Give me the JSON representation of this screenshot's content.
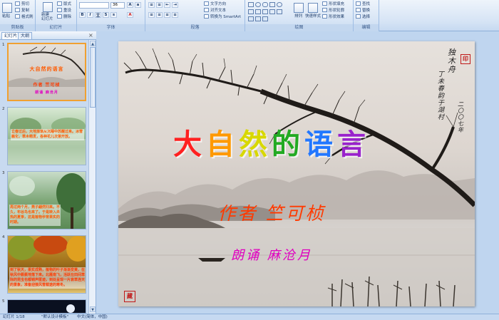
{
  "ribbon": {
    "groups": [
      {
        "name": "剪贴板",
        "items": [
          "剪切",
          "复制",
          "格式刷"
        ],
        "big": "粘贴"
      },
      {
        "name": "幻灯片",
        "items": [
          "版式",
          "重设",
          "删除"
        ],
        "big": "新建\n幻灯片"
      },
      {
        "name": "字体",
        "font_size": "36"
      },
      {
        "name": "段落",
        "items": [
          "文字方向",
          "对齐文本",
          "转换为 SmartArt"
        ]
      },
      {
        "name": "绘图",
        "items": [
          "排列",
          "快速样式",
          "形状填充",
          "形状轮廓",
          "形状效果"
        ]
      },
      {
        "name": "编辑",
        "items": [
          "查找",
          "替换",
          "选择"
        ]
      }
    ]
  },
  "pane": {
    "tabs": [
      "幻灯片",
      "大纲"
    ],
    "slides": [
      {
        "num": "1",
        "title": "大自然的语言",
        "subtitle": "作者 竺可桢",
        "reader": "朗诵 麻沧月"
      },
      {
        "num": "2",
        "text": "立春过后，大地渐渐从沉睡中苏醒过来。冰雪融化，草木萌发，各种花儿次第开放。"
      },
      {
        "num": "3",
        "text": "再过两个月，燕子翩然归来。不久，布谷鸟也来了。于是转入炎热的夏季，这是植物孕育果实的时期。"
      },
      {
        "num": "4",
        "text": "到了秋天，果实成熟，植物的叶子渐渐变黄，在秋风中簌簌地落下来。北雁南飞，活跃在田间草际的昆虫也都销声匿迹。到处呈现一片衰草连天的景象，准备迎接风雪载途的寒冬。"
      },
      {
        "num": "5"
      }
    ]
  },
  "slide": {
    "title_chars": [
      "大",
      "自",
      "然",
      "的",
      "语",
      "言"
    ],
    "title_colors": [
      "#ff2020",
      "#ff9900",
      "#d8d800",
      "#22aa22",
      "#2277ff",
      "#9922cc"
    ],
    "author": "作者  竺可桢",
    "reader": "朗诵  麻沧月",
    "calligraphy": [
      "独木舟",
      "丁未春韵于湖村",
      "二〇〇七年"
    ],
    "seal_top": "印",
    "seal_bottom": "藏"
  },
  "status": {
    "slide_info": "幻灯片 1/18",
    "theme": "\"默认设计模板\"",
    "language": "中文(简体，中国)"
  },
  "colors": {
    "ribbon_bg": "#d6e4f5",
    "pane_bg": "#c8daf0",
    "selected_border": "#f0a030"
  }
}
